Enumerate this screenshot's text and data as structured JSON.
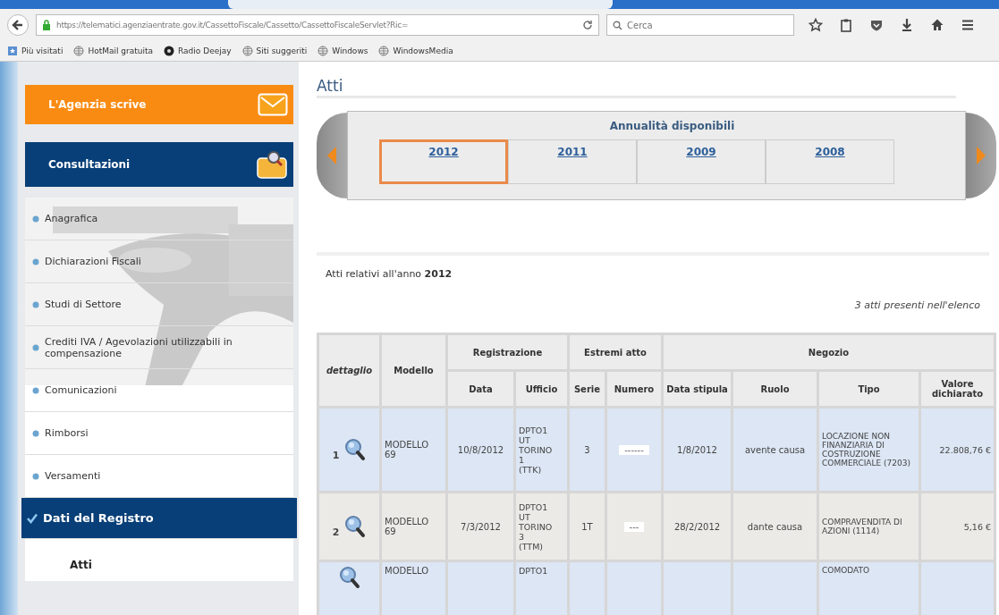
{
  "browser": {
    "url": "https://telematici.agenziaentrate.gov.it/CassettoFiscale/Cassetto/CassettoFiscaleServlet?Ric=",
    "search": {
      "placeholder": "Cerca"
    },
    "bookmarks": [
      {
        "label": "Più visitati",
        "kind": "star"
      },
      {
        "label": "HotMail gratuita",
        "kind": "globe"
      },
      {
        "label": "Radio Deejay",
        "kind": "radio"
      },
      {
        "label": "Siti suggeriti",
        "kind": "globe"
      },
      {
        "label": "Windows",
        "kind": "globe"
      },
      {
        "label": "WindowsMedia",
        "kind": "globe"
      }
    ]
  },
  "sidebar": {
    "banners": [
      {
        "label": "L'Agenzia scrive",
        "kind": "mail"
      },
      {
        "label": "Consultazioni",
        "kind": "search"
      }
    ],
    "items": [
      {
        "label": "Anagrafica",
        "selected": false
      },
      {
        "label": "Dichiarazioni Fiscali",
        "selected": false
      },
      {
        "label": "Studi di Settore",
        "selected": false
      },
      {
        "label": "Crediti IVA / Agevolazioni utilizzabili in compensazione",
        "selected": false
      },
      {
        "label": "Comunicazioni",
        "selected": false
      },
      {
        "label": "Rimborsi",
        "selected": false
      },
      {
        "label": "Versamenti",
        "selected": false
      },
      {
        "label": "Dati del Registro",
        "selected": true
      }
    ],
    "subitems": [
      {
        "label": "Atti"
      }
    ]
  },
  "page": {
    "title": "Atti",
    "years": {
      "title": "Annualità disponibili",
      "items": [
        {
          "label": "2012",
          "selected": true
        },
        {
          "label": "2011",
          "selected": false
        },
        {
          "label": "2009",
          "selected": false
        },
        {
          "label": "2008",
          "selected": false
        }
      ]
    },
    "intro": "Atti relativi all'anno **2012**",
    "count": "3 atti presenti nell'elenco",
    "table": {
      "groups": [
        "Registrazione",
        "Estremi atto",
        "Negozio"
      ],
      "columns": [
        "dettaglio",
        "Modello",
        "Data",
        "Ufficio",
        "Serie",
        "Numero",
        "Data stipula",
        "Ruolo",
        "Tipo",
        "Valore dichiarato"
      ],
      "rows": [
        {
          "index": "1",
          "modello": "MODELLO 69",
          "data": "10/8/2012",
          "ufficio": "DPTO1 UT TORINO 1 (TTK)",
          "serie": "3",
          "numero": "------",
          "data_stipula": "1/8/2012",
          "ruolo": "avente causa",
          "tipo": "LOCAZIONE NON FINANZIARIA DI COSTRUZIONE COMMERCIALE (7203)",
          "valore": "22.808,76 €"
        },
        {
          "index": "2",
          "modello": "MODELLO 69",
          "data": "7/3/2012",
          "ufficio": "DPTO1 UT TORINO 3 (TTM)",
          "serie": "1T",
          "numero": "---",
          "data_stipula": "28/2/2012",
          "ruolo": "dante causa",
          "tipo": "COMPRAVENDITA DI AZIONI (1114)",
          "valore": "5,16 €"
        },
        {
          "index": "",
          "modello": "MODELLO",
          "data": "",
          "ufficio": "DPTO1",
          "serie": "",
          "numero": "",
          "data_stipula": "",
          "ruolo": "",
          "tipo": "COMODATO",
          "valore": ""
        }
      ]
    }
  }
}
